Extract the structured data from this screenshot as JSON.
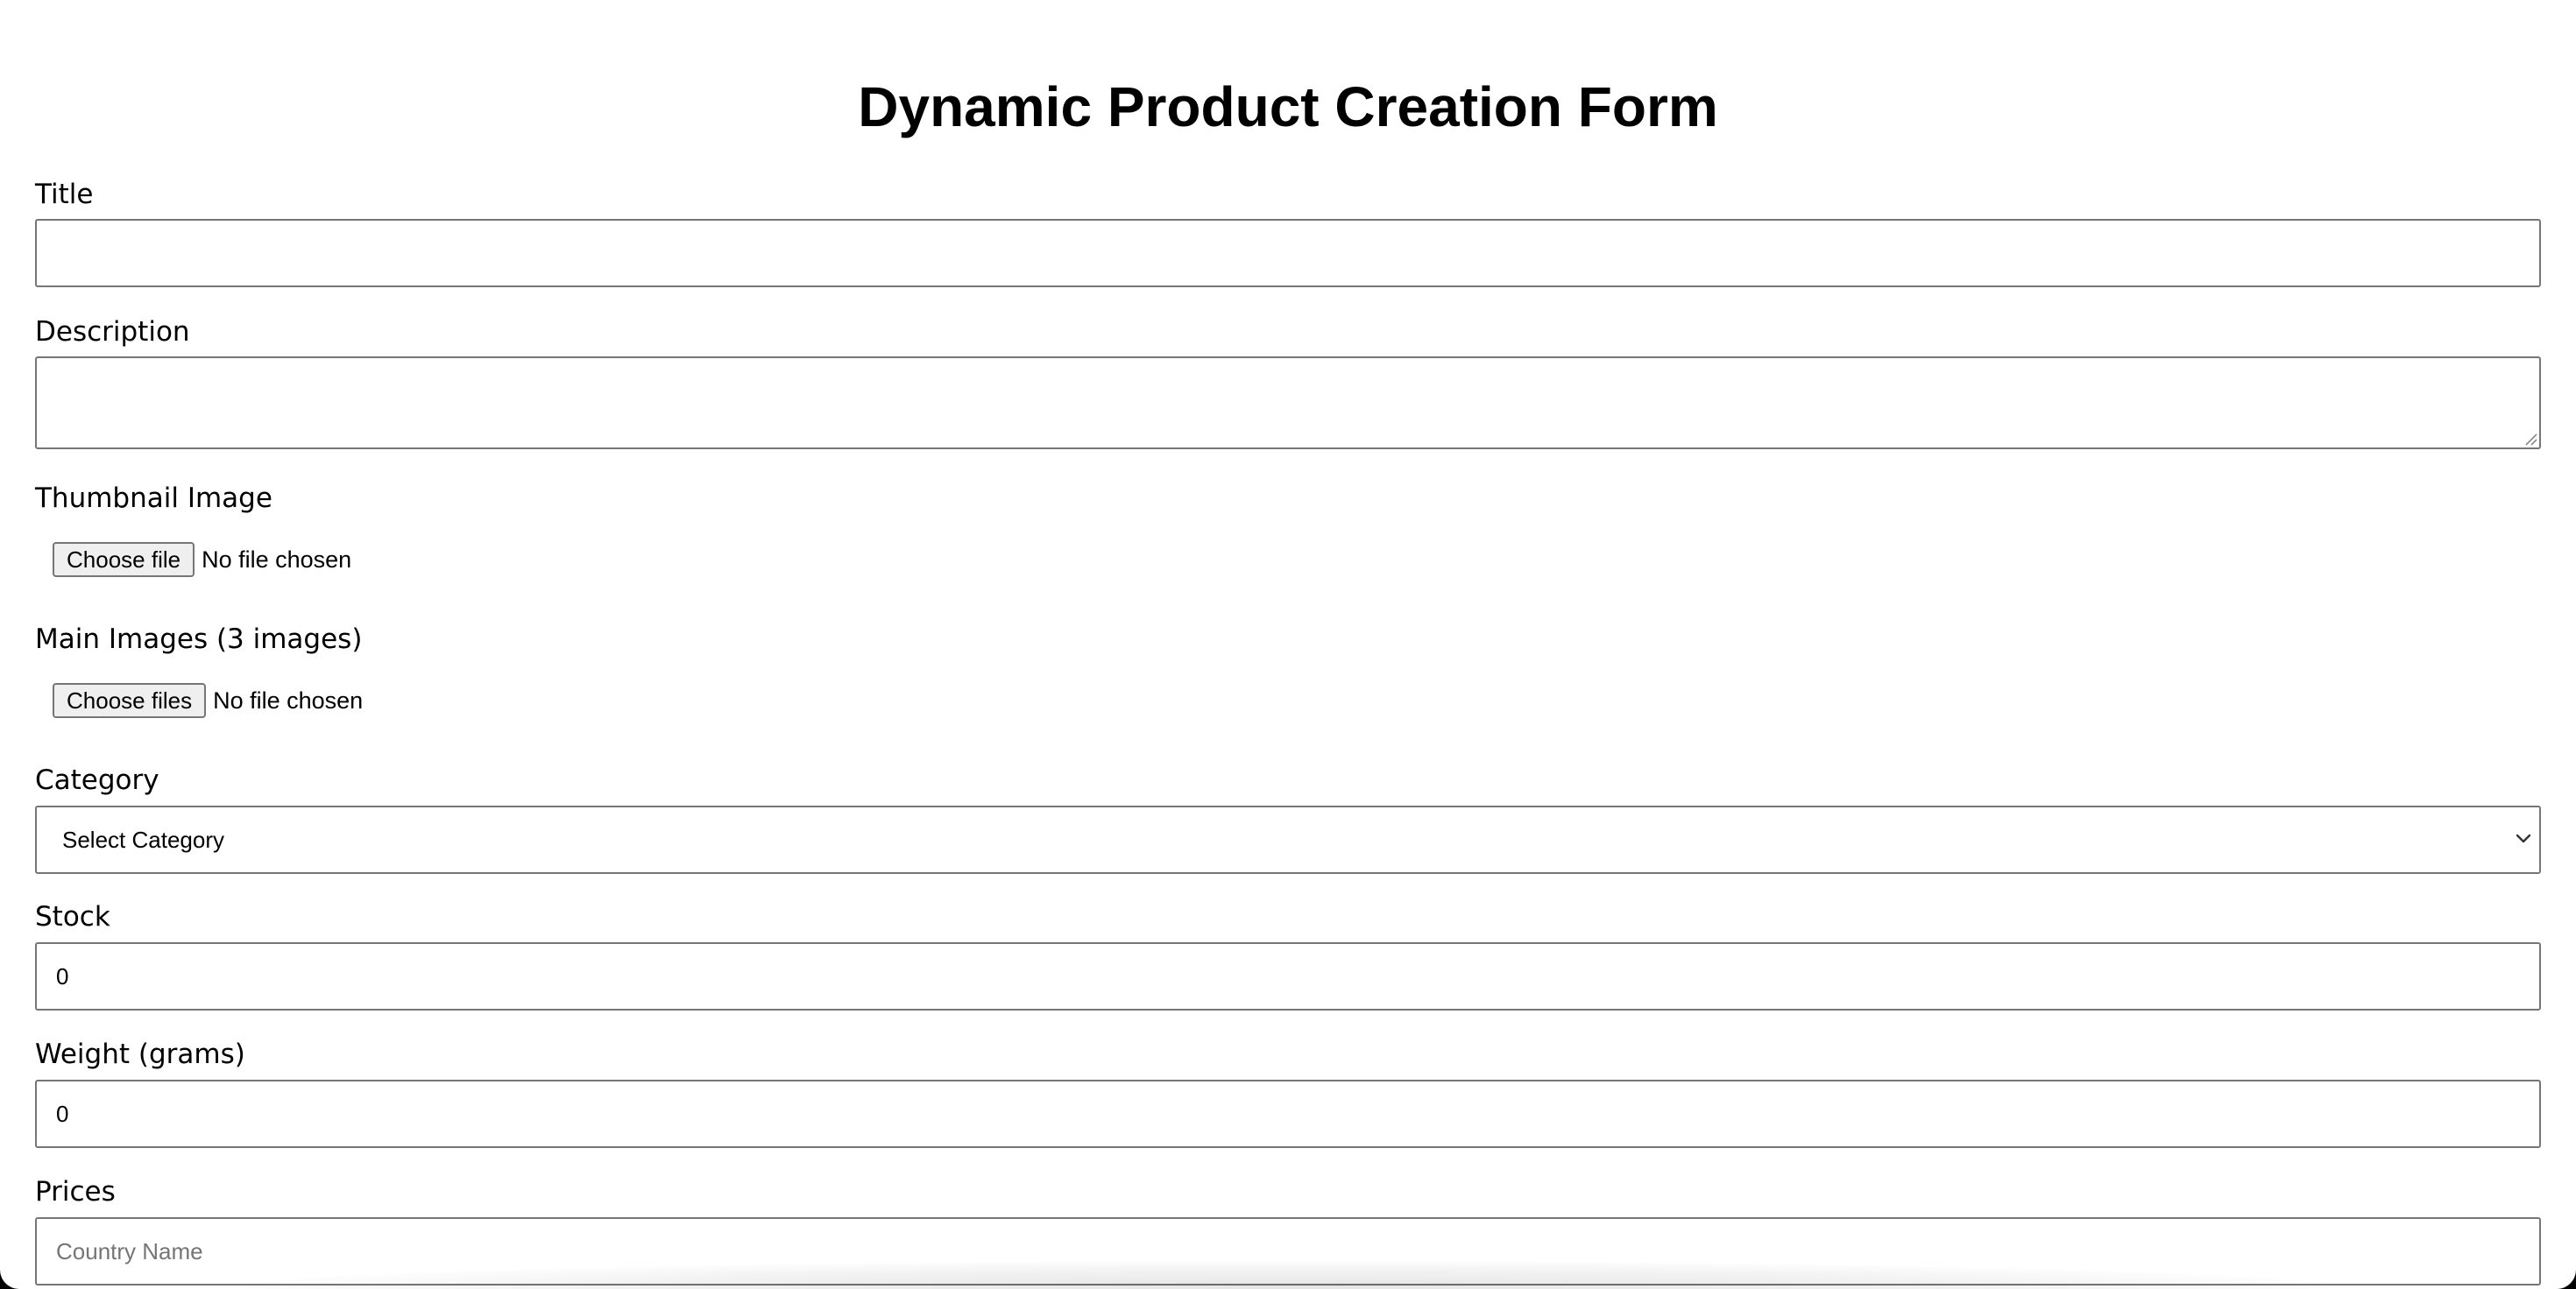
{
  "form": {
    "title": "Dynamic Product Creation Form"
  },
  "fields": {
    "title": {
      "label": "Title",
      "value": ""
    },
    "description": {
      "label": "Description",
      "value": ""
    },
    "thumbnail": {
      "label": "Thumbnail Image",
      "button": "Choose file",
      "status": "No file chosen"
    },
    "main_images": {
      "label": "Main Images (3 images)",
      "button": "Choose files",
      "status": "No file chosen"
    },
    "category": {
      "label": "Category",
      "selected": "Select Category"
    },
    "stock": {
      "label": "Stock",
      "value": "0"
    },
    "weight": {
      "label": "Weight (grams)",
      "value": "0"
    },
    "prices": {
      "label": "Prices",
      "country_placeholder": "Country Name"
    }
  },
  "icons": {
    "select_arrow": "chevron-down-icon",
    "textarea_grip": "resize-grip-icon"
  },
  "colors": {
    "border": "#767676",
    "button_bg": "#efefef",
    "placeholder": "#757575"
  }
}
